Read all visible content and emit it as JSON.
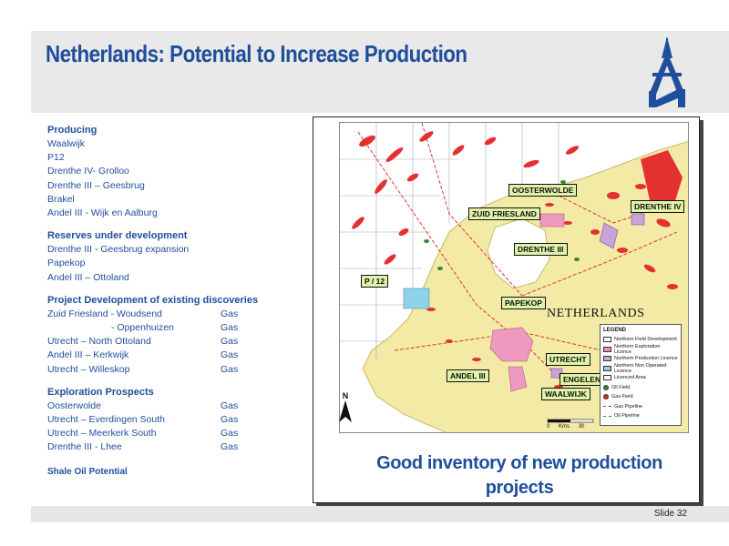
{
  "title": "Netherlands: Potential to Increase Production",
  "sections": {
    "producing": {
      "heading": "Producing",
      "items": [
        "Waalwijk",
        "P12",
        "Drenthe IV- Grolloo",
        "Drenthe III – Geesbrug",
        "Brakel",
        "Andel III - Wijk en Aalburg"
      ]
    },
    "reserves": {
      "heading": "Reserves under development",
      "items": [
        "Drenthe III - Geesbrug expansion",
        "Papekop",
        "Andel III – Ottoland"
      ]
    },
    "project_dev": {
      "heading": "Project Development of existing discoveries",
      "rows": [
        {
          "name": "Zuid Friesland -  Woudsend",
          "type": "Gas"
        },
        {
          "name": "-  Oppenhuizen",
          "type": "Gas"
        },
        {
          "name": "Utrecht – North Ottoland",
          "type": "Gas"
        },
        {
          "name": "Andel III – Kerkwijk",
          "type": "Gas"
        },
        {
          "name": "Utrecht – Willeskop",
          "type": "Gas"
        }
      ]
    },
    "exploration": {
      "heading": "Exploration Prospects",
      "rows": [
        {
          "name": "Oosterwolde",
          "type": "Gas"
        },
        {
          "name": "Utrecht – Everdingen South",
          "type": "Gas"
        },
        {
          "name": "Utrecht – Meerkerk South",
          "type": "Gas"
        },
        {
          "name": "Drenthe III - Lhee",
          "type": "Gas"
        }
      ]
    },
    "shale": "Shale Oil Potential"
  },
  "map": {
    "country_label": "NETHERLANDS",
    "north_label": "N",
    "scale_label": "Kms",
    "scale_zero": "0",
    "scale_max": "30",
    "licence_labels": {
      "oosterwolde": "OOSTERWOLDE",
      "drenthe_iv": "DRENTHE IV",
      "zuid_friesland": "ZUID FRIESLAND",
      "drenthe_iii": "DRENTHE III",
      "p12": "P / 12",
      "papekop": "PAPEKOP",
      "utrecht": "UTRECHT",
      "andel_iii": "ANDEL III",
      "engelen": "ENGELEN",
      "waalwijk": "WAALWIJK"
    },
    "legend": {
      "title": "LEGEND",
      "items": [
        {
          "label": "Northern Field Development",
          "swatch": "#ffffff"
        },
        {
          "label": "Northern Exploration Licence",
          "swatch": "#e98fb7"
        },
        {
          "label": "Northern Production Licence",
          "swatch": "#c9a6d8"
        },
        {
          "label": "Northern Non Operated Licence",
          "swatch": "#8fd3ea"
        },
        {
          "label": "Licenced Area",
          "swatch": "#ffffff"
        },
        {
          "label": "Oil Field",
          "swatch": "#2e8b2e"
        },
        {
          "label": "Gas Field",
          "swatch": "#e02020"
        },
        {
          "label": "Gas Pipeline",
          "swatch": "#e02020"
        },
        {
          "label": "Oil Pipeline",
          "swatch": "#2e8b2e"
        }
      ]
    },
    "colors": {
      "sea": "#ffffff",
      "land": "#f3eaa6",
      "label_bg": "#dff2a8",
      "gas": "#e53030",
      "oil": "#2e8b2e",
      "pink": "#ee9ac0",
      "purple": "#c7a3d8",
      "cyan": "#8fd3ea"
    }
  },
  "caption": {
    "line1": "Good inventory of new production",
    "line2": "projects"
  },
  "slide_number": "Slide 32",
  "colors": {
    "brand": "#1f4e9c",
    "band": "#e9e9e9"
  }
}
